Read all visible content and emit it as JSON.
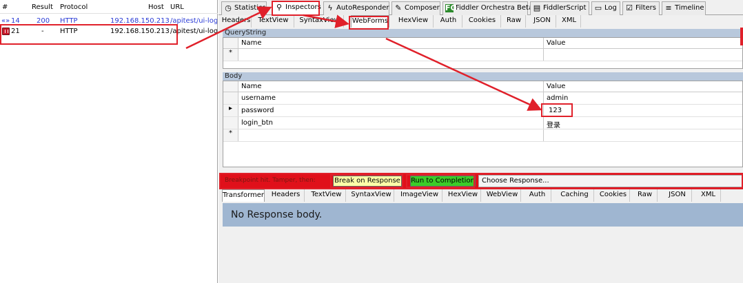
{
  "sessions": {
    "columns": [
      "#",
      "Result",
      "Protocol",
      "Host",
      "URL"
    ],
    "rows": [
      {
        "id": "14",
        "result": "200",
        "protocol": "HTTP",
        "host": "192.168.150.213",
        "url": "/apitest/ui-login"
      },
      {
        "id": "21",
        "result": "-",
        "protocol": "HTTP",
        "host": "192.168.150.213",
        "url": "/apitest/ui-login"
      }
    ]
  },
  "main_tabs": [
    {
      "label": "Statistics",
      "icon": "stopwatch-icon"
    },
    {
      "label": "Inspectors",
      "icon": "magnifier-icon"
    },
    {
      "label": "AutoResponder",
      "icon": "lightning-icon"
    },
    {
      "label": "Composer",
      "icon": "pencil-icon"
    },
    {
      "label": "Fiddler Orchestra Beta",
      "icon": "fo-icon",
      "badge": "FO"
    },
    {
      "label": "FiddlerScript",
      "icon": "script-icon"
    },
    {
      "label": "Log",
      "icon": "log-icon"
    },
    {
      "label": "Filters",
      "icon": "checkbox-icon"
    },
    {
      "label": "Timeline",
      "icon": "timeline-icon"
    }
  ],
  "request_tabs": [
    "Headers",
    "TextView",
    "SyntaxView",
    "WebForms",
    "HexView",
    "Auth",
    "Cookies",
    "Raw",
    "JSON",
    "XML"
  ],
  "querystring": {
    "title": "QueryString",
    "col_name": "Name",
    "col_value": "Value",
    "new_row_marker": "*"
  },
  "body": {
    "title": "Body",
    "col_name": "Name",
    "col_value": "Value",
    "rows": [
      {
        "name": "username",
        "value": "admin"
      },
      {
        "name": "password",
        "value": "123"
      },
      {
        "name": "login_btn",
        "value": "登录"
      }
    ],
    "new_row_marker": "*"
  },
  "breakpoint": {
    "label": "Breakpoint hit. Tamper, then:",
    "break_on_response": "Break on Response",
    "run_to_completion": "Run to Completion",
    "choose_response": "Choose Response..."
  },
  "response_tabs": [
    "Transformer",
    "Headers",
    "TextView",
    "SyntaxView",
    "ImageView",
    "HexView",
    "WebView",
    "Auth",
    "Caching",
    "Cookies",
    "Raw",
    "JSON",
    "XML"
  ],
  "response_body": "No Response body.",
  "colors": {
    "annotation": "#e0202a",
    "breakpoint_bar": "#e0101a",
    "break_button": "#ffffa8",
    "run_button": "#3ccc28",
    "section_header": "#b8c8dc",
    "response_body_bg": "#9fb6d1"
  }
}
